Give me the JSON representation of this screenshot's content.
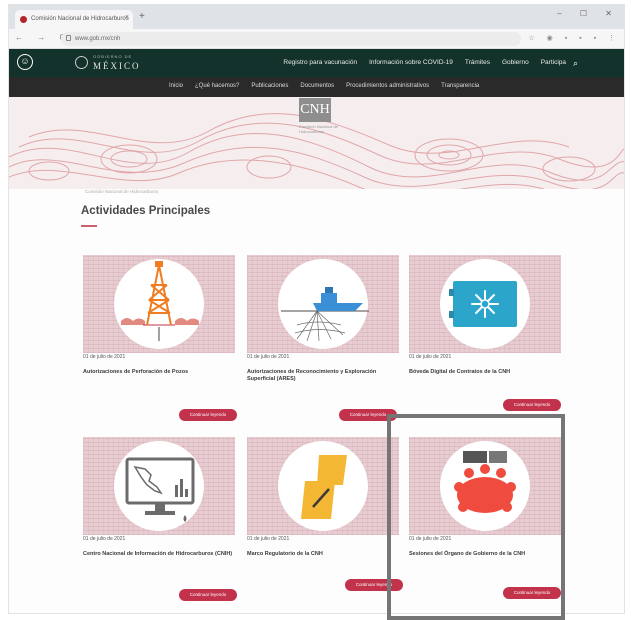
{
  "browser": {
    "tab_title": "Comisión Nacional de Hidrocarburos",
    "tab_close": "×",
    "new_tab": "+",
    "window_controls": "– ☐ ✕",
    "nav_buttons": "← → C",
    "url": "www.gob.mx/cnh",
    "extension_icons": "☆ ◉ ▪ ▪ ▪ ⋮"
  },
  "gob_header": {
    "logo_small": "GOBIERNO DE",
    "logo_text": "MÉXICO",
    "nav": [
      "Registro para vacunación",
      "Información sobre COVID-19",
      "Trámites",
      "Gobierno",
      "Participa"
    ],
    "search_icon": "search-icon"
  },
  "cnh_nav": {
    "items": [
      "Inicio",
      "¿Qué hacemos?",
      "Publicaciones",
      "Documentos",
      "Procedimientos administrativos",
      "Transparencia"
    ]
  },
  "hero": {
    "logo": "CNH",
    "logo_sub": "Comisión Nacional de Hidrocarburos",
    "breadcrumb": "Comisión Nacional de Hidrocarburos"
  },
  "section": {
    "title": "Actividades Principales"
  },
  "colors": {
    "header_bg": "#13322b",
    "accent": "#c2324a",
    "card_bg": "#e7cdd1"
  },
  "cards": [
    {
      "date": "01 de julio de 2021",
      "title": "Autorizaciones de Perforación de Pozos",
      "button": "Continuar leyendo",
      "icon": "drilling-rig-icon"
    },
    {
      "date": "01 de julio de 2021",
      "title": "Autorizaciones de Reconocimiento y Exploración Superficial (ARES)",
      "button": "Continuar leyendo",
      "icon": "survey-ship-icon"
    },
    {
      "date": "01 de julio de 2021",
      "title": "Bóveda Digital de Contratos de la CNH",
      "button": "Continuar leyendo",
      "icon": "digital-vault-icon"
    },
    {
      "date": "01 de julio de 2021",
      "title": "Centro Nacional de Información de Hidrocarburos (CNIH)",
      "button": "Continuar leyendo",
      "icon": "monitor-map-icon"
    },
    {
      "date": "01 de julio de 2021",
      "title": "Marco Regulatorio de la CNH",
      "button": "Continuar leyendo",
      "icon": "regulatory-documents-icon"
    },
    {
      "date": "01 de julio de 2021",
      "title": "Sesiones del Órgano de Gobierno de la CNH",
      "button": "Continuar leyendo",
      "icon": "board-meeting-icon"
    }
  ]
}
